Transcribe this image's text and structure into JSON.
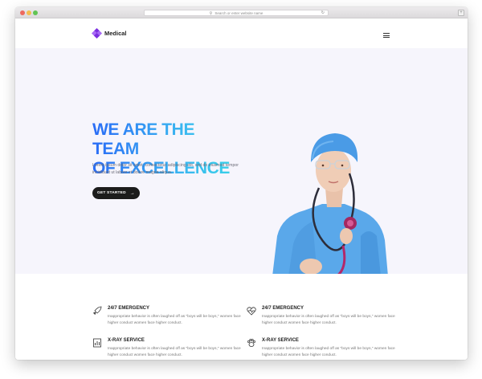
{
  "browser": {
    "address_placeholder": "Search or enter website name"
  },
  "header": {
    "brand": "Medical",
    "brand_color": "#7b2fe0",
    "menu_icon": "hamburger-menu-icon"
  },
  "hero": {
    "title_line1": "WE ARE THE TEAM",
    "title_line2": "OF EXCELLENCE",
    "description": "Lorem ipsum dolor sit amet, consectetur adipiscing elit, sed do eiusmod tempor incididunt ut labore et dolore magna aliqua.",
    "cta_label": "GET STARTED",
    "gradient_colors": [
      "#2a6cf6",
      "#36d6e6"
    ]
  },
  "features": [
    {
      "icon": "rocket-icon",
      "title": "24/7 EMERGENCY",
      "description": "Inappropriate behavior is often laughed off as \"boys will be boys,\" women face higher conduct women face higher conduct."
    },
    {
      "icon": "heartbeat-icon",
      "title": "24/7 EMERGENCY",
      "description": "Inappropriate behavior is often laughed off as \"boys will be boys,\" women face higher conduct women face higher conduct."
    },
    {
      "icon": "xray-report-icon",
      "title": "X-RAY SERVICE",
      "description": "Inappropriate behavior is often laughed off as \"boys will be boys,\" women face higher conduct women face higher conduct."
    },
    {
      "icon": "paw-icon",
      "title": "X-RAY SERVICE",
      "description": "Inappropriate behavior is often laughed off as \"boys will be boys,\" women face higher conduct women face higher conduct."
    }
  ]
}
